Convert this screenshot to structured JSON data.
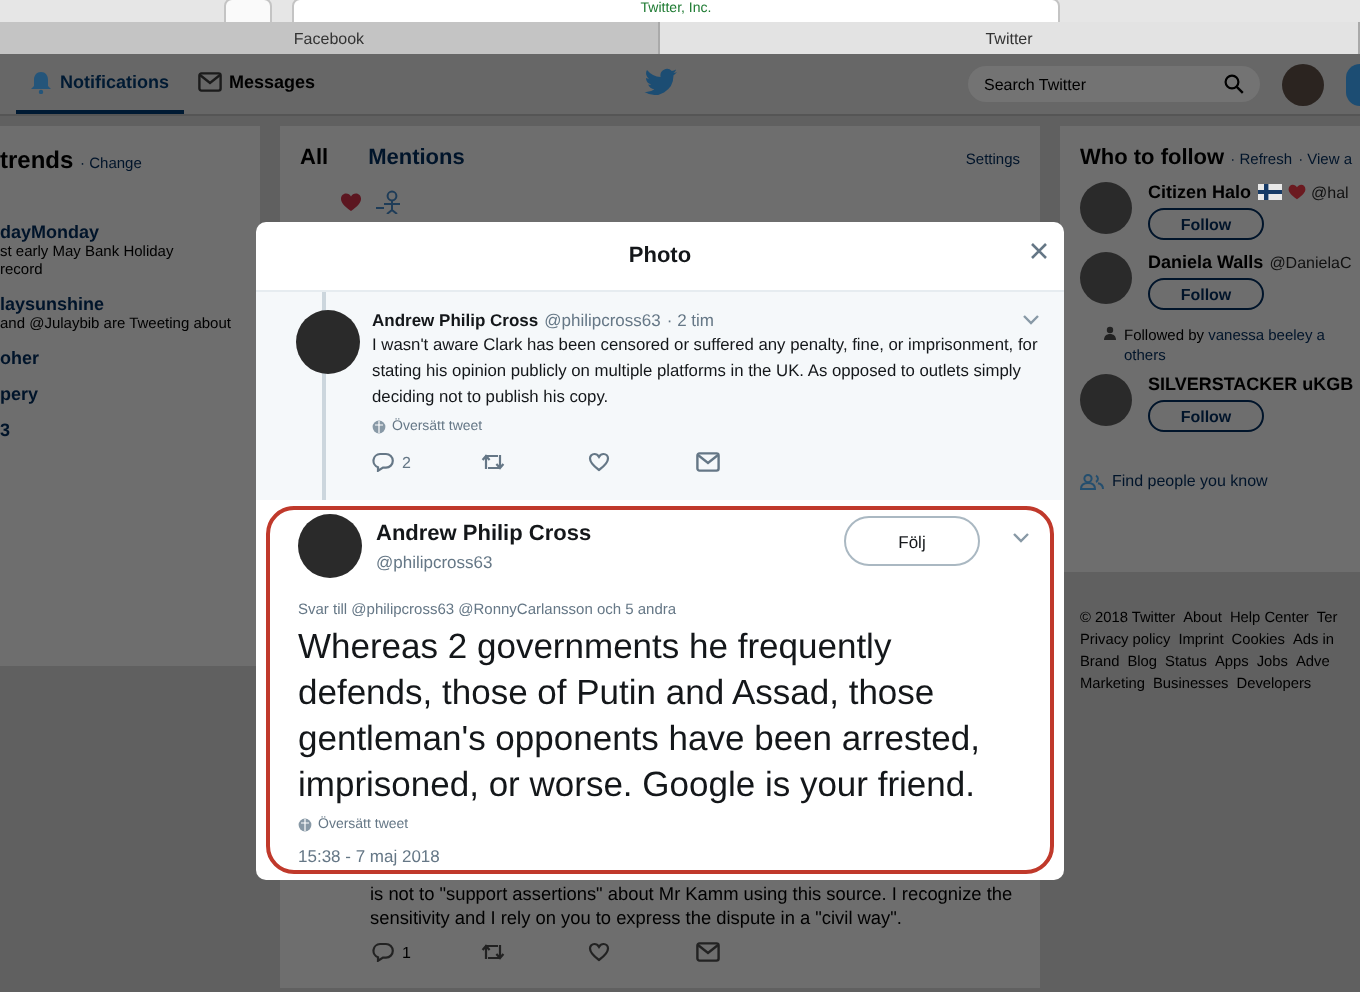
{
  "browser": {
    "address": "Twitter, Inc.",
    "tabs": [
      {
        "label": "Facebook",
        "selected": false
      },
      {
        "label": "Twitter",
        "selected": true
      }
    ]
  },
  "nav": {
    "items": [
      {
        "label": "Notifications",
        "selected": true
      },
      {
        "label": "Messages",
        "selected": false
      }
    ],
    "search": {
      "placeholder": "Search Twitter"
    }
  },
  "trends": {
    "title": "trends",
    "action": "· Change",
    "items": [
      {
        "name": "dayMonday",
        "lines": [
          "st early May Bank Holiday",
          "record"
        ]
      },
      {
        "name": "laysunshine",
        "lines": [
          "and @Julaybib are Tweeting about"
        ]
      },
      {
        "name": "oher"
      },
      {
        "name": "pery"
      },
      {
        "name": "3"
      }
    ]
  },
  "timeline": {
    "tabs": [
      {
        "label": "All",
        "selected": true
      },
      {
        "label": "Mentions",
        "selected": false
      }
    ],
    "settings": "Settings",
    "tweet": {
      "text": "is not to \"support assertions\" about Mr Kamm using this source. I recognize the sensitivity and I rely on you to express the dispute in a \"civil way\".",
      "replies": "1"
    }
  },
  "who_to_follow": {
    "title": "Who to follow",
    "links": [
      "· Refresh",
      "· View a"
    ],
    "accounts": [
      {
        "name": "Citizen Halo",
        "handle": "@hal",
        "emoji": true,
        "button": "Follow"
      },
      {
        "name": "Daniela Walls",
        "handle": "@DanielaC",
        "emoji": false,
        "button": "Follow"
      },
      {
        "name": "SILVERSTACKER uKGB",
        "emoji": false,
        "context": "Followed by",
        "context_link": "vanessa beeley a",
        "context_more": "others",
        "button": "Follow"
      }
    ],
    "find": "Find people you know"
  },
  "footer": [
    [
      "© 2018 Twitter",
      "About",
      "Help Center",
      "Ter"
    ],
    [
      "Privacy policy",
      "Imprint",
      "Cookies",
      "Ads in"
    ],
    [
      "Brand",
      "Blog",
      "Status",
      "Apps",
      "Jobs",
      "Adve"
    ],
    [
      "Marketing",
      "Businesses",
      "Developers"
    ]
  ],
  "modal": {
    "title": "Photo",
    "tweets": [
      {
        "kind": "reply",
        "name": "Andrew Philip Cross",
        "handle": "@philipcross63",
        "time": "· 2 tim",
        "text": "I wasn't aware Clark has been censored or suffered any penalty, fine, or imprisonment, for stating his opinion publicly on multiple platforms in the UK. As opposed to outlets simply deciding not to publish his copy.",
        "translate": "Översätt tweet",
        "replies": "2"
      },
      {
        "kind": "focused",
        "highlighted": true,
        "name": "Andrew Philip Cross",
        "handle": "@philipcross63",
        "follow": "Följ",
        "reply_to": "Svar till @philipcross63 @RonnyCarlansson och 5 andra",
        "text": "Whereas 2 governments he frequently defends, those of Putin and Assad, those gentleman's opponents have been arrested, imprisoned, or worse. Google is your friend.",
        "translate": "Översätt tweet",
        "timestamp": "15:38 - 7 maj 2018"
      }
    ]
  }
}
